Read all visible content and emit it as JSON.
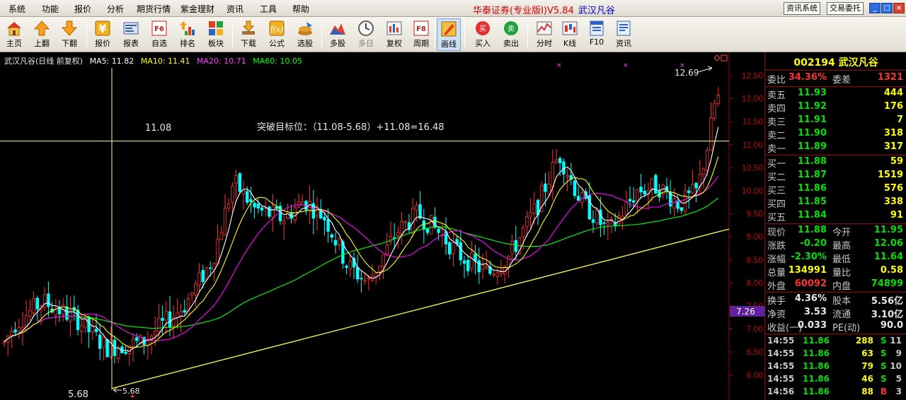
{
  "menu": [
    "系统",
    "功能",
    "报价",
    "分析",
    "期货行情",
    "紫金理财",
    "资讯",
    "工具",
    "帮助"
  ],
  "app_title": "华泰证券(专业版Ⅰ)V5.84",
  "app_stock": "武汉凡谷",
  "top_buttons": {
    "news": "资讯系统",
    "trade": "交易委托"
  },
  "window_controls": {
    "min": "_",
    "restore": "□",
    "close": "×"
  },
  "toolbar": [
    {
      "label": "主页",
      "icon": "home-icon"
    },
    {
      "label": "上翻",
      "icon": "arrow-up-icon"
    },
    {
      "label": "下翻",
      "icon": "arrow-down-icon"
    },
    {
      "label": "报价",
      "icon": "yen-icon"
    },
    {
      "label": "报表",
      "icon": "report-icon"
    },
    {
      "label": "自选",
      "icon": "f6-icon"
    },
    {
      "label": "排名",
      "icon": "ranking-icon"
    },
    {
      "label": "板块",
      "icon": "sector-icon"
    },
    {
      "label": "下载",
      "icon": "download-icon"
    },
    {
      "label": "公式",
      "icon": "formula-icon"
    },
    {
      "label": "选股",
      "icon": "stock-pick-icon"
    },
    {
      "label": "多股",
      "icon": "multi-stock-icon"
    },
    {
      "label": "多日",
      "icon": "multi-day-icon"
    },
    {
      "label": "复权",
      "icon": "adjust-icon"
    },
    {
      "label": "周期",
      "icon": "f8-icon"
    },
    {
      "label": "画线",
      "icon": "draw-line-icon"
    },
    {
      "label": "买入",
      "icon": "buy-icon"
    },
    {
      "label": "卖出",
      "icon": "sell-icon"
    },
    {
      "label": "分时",
      "icon": "intraday-icon"
    },
    {
      "label": "K线",
      "icon": "kline-icon"
    },
    {
      "label": "F10",
      "icon": "f10-icon"
    },
    {
      "label": "资讯",
      "icon": "news-icon"
    }
  ],
  "chart_header": {
    "name": "武汉凡谷(日线 前复权)",
    "ma5": "MA5: 11.82",
    "ma10": "MA10: 11.41",
    "ma20": "MA20: 10.71",
    "ma60": "MA60: 10.05"
  },
  "annotations": {
    "h_line_label": "11.08",
    "target_text": "突破目标位：（11.08-5.68）+11.08=16.48",
    "low_label_left": "5.68",
    "low_label_arrow": "5.68",
    "high_label": "12.69",
    "cursor_value": "7.26"
  },
  "chart_data": {
    "type": "candlestick",
    "y_ticks": [
      "12.50",
      "12.00",
      "11.50",
      "11.00",
      "10.50",
      "10.00",
      "9.50",
      "9.00",
      "8.50",
      "8.00",
      "7.50",
      "7.00",
      "6.50",
      "6.00"
    ],
    "ylim": [
      5.68,
      12.69
    ],
    "horizontal_line": 11.08,
    "period_low": 5.68,
    "period_high": 12.69,
    "ma_last": {
      "MA5": 11.82,
      "MA10": 11.41,
      "MA20": 10.71,
      "MA60": 10.05
    },
    "colors": {
      "up": "#ff3030",
      "down": "#00ffff",
      "MA5": "#ffffff",
      "MA10": "#ffff00",
      "MA20": "#ff00ff",
      "MA60": "#00ff00",
      "trendline": "#ffff40"
    }
  },
  "quote": {
    "code": "002194",
    "name": "武汉凡谷",
    "weibi_label": "委比",
    "weibi": "34.36%",
    "weicha_label": "委差",
    "weicha": "1321",
    "asks": [
      {
        "label": "卖五",
        "price": "11.93",
        "vol": "444"
      },
      {
        "label": "卖四",
        "price": "11.92",
        "vol": "176"
      },
      {
        "label": "卖三",
        "price": "11.91",
        "vol": "7"
      },
      {
        "label": "卖二",
        "price": "11.90",
        "vol": "318"
      },
      {
        "label": "卖一",
        "price": "11.89",
        "vol": "317"
      }
    ],
    "bids": [
      {
        "label": "买一",
        "price": "11.88",
        "vol": "59"
      },
      {
        "label": "买二",
        "price": "11.87",
        "vol": "1519"
      },
      {
        "label": "买三",
        "price": "11.86",
        "vol": "576"
      },
      {
        "label": "买四",
        "price": "11.85",
        "vol": "338"
      },
      {
        "label": "买五",
        "price": "11.84",
        "vol": "91"
      }
    ],
    "stats": [
      {
        "l1": "现价",
        "v1": "11.88",
        "c1": "green",
        "l2": "今开",
        "v2": "11.95",
        "c2": "green"
      },
      {
        "l1": "涨跌",
        "v1": "-0.20",
        "c1": "green",
        "l2": "最高",
        "v2": "12.06",
        "c2": "green"
      },
      {
        "l1": "涨幅",
        "v1": "-2.30%",
        "c1": "green",
        "l2": "最低",
        "v2": "11.64",
        "c2": "green"
      },
      {
        "l1": "总量",
        "v1": "134991",
        "c1": "yellow",
        "l2": "量比",
        "v2": "0.58",
        "c2": "yellow"
      },
      {
        "l1": "外盘",
        "v1": "60092",
        "c1": "red",
        "l2": "内盘",
        "v2": "74899",
        "c2": "green"
      }
    ],
    "fund": [
      {
        "l1": "换手",
        "v1": "4.36%",
        "c1": "white",
        "l2": "股本",
        "v2": "5.56亿",
        "c2": "white"
      },
      {
        "l1": "净资",
        "v1": "3.53",
        "c1": "white",
        "l2": "流通",
        "v2": "3.10亿",
        "c2": "white"
      },
      {
        "l1": "收益(一)",
        "v1": "0.033",
        "c1": "white",
        "l2": "PE(动)",
        "v2": "90.0",
        "c2": "white"
      }
    ],
    "ticks": [
      {
        "time": "14:55",
        "price": "11.86",
        "vol": "288",
        "flag": "S",
        "n": "11"
      },
      {
        "time": "14:55",
        "price": "11.86",
        "vol": "63",
        "flag": "S",
        "n": "9"
      },
      {
        "time": "14:55",
        "price": "11.86",
        "vol": "79",
        "flag": "S",
        "n": "10"
      },
      {
        "time": "14:55",
        "price": "11.86",
        "vol": "46",
        "flag": "S",
        "n": "5"
      },
      {
        "time": "14:56",
        "price": "11.86",
        "vol": "88",
        "flag": "B",
        "n": "3"
      }
    ]
  }
}
